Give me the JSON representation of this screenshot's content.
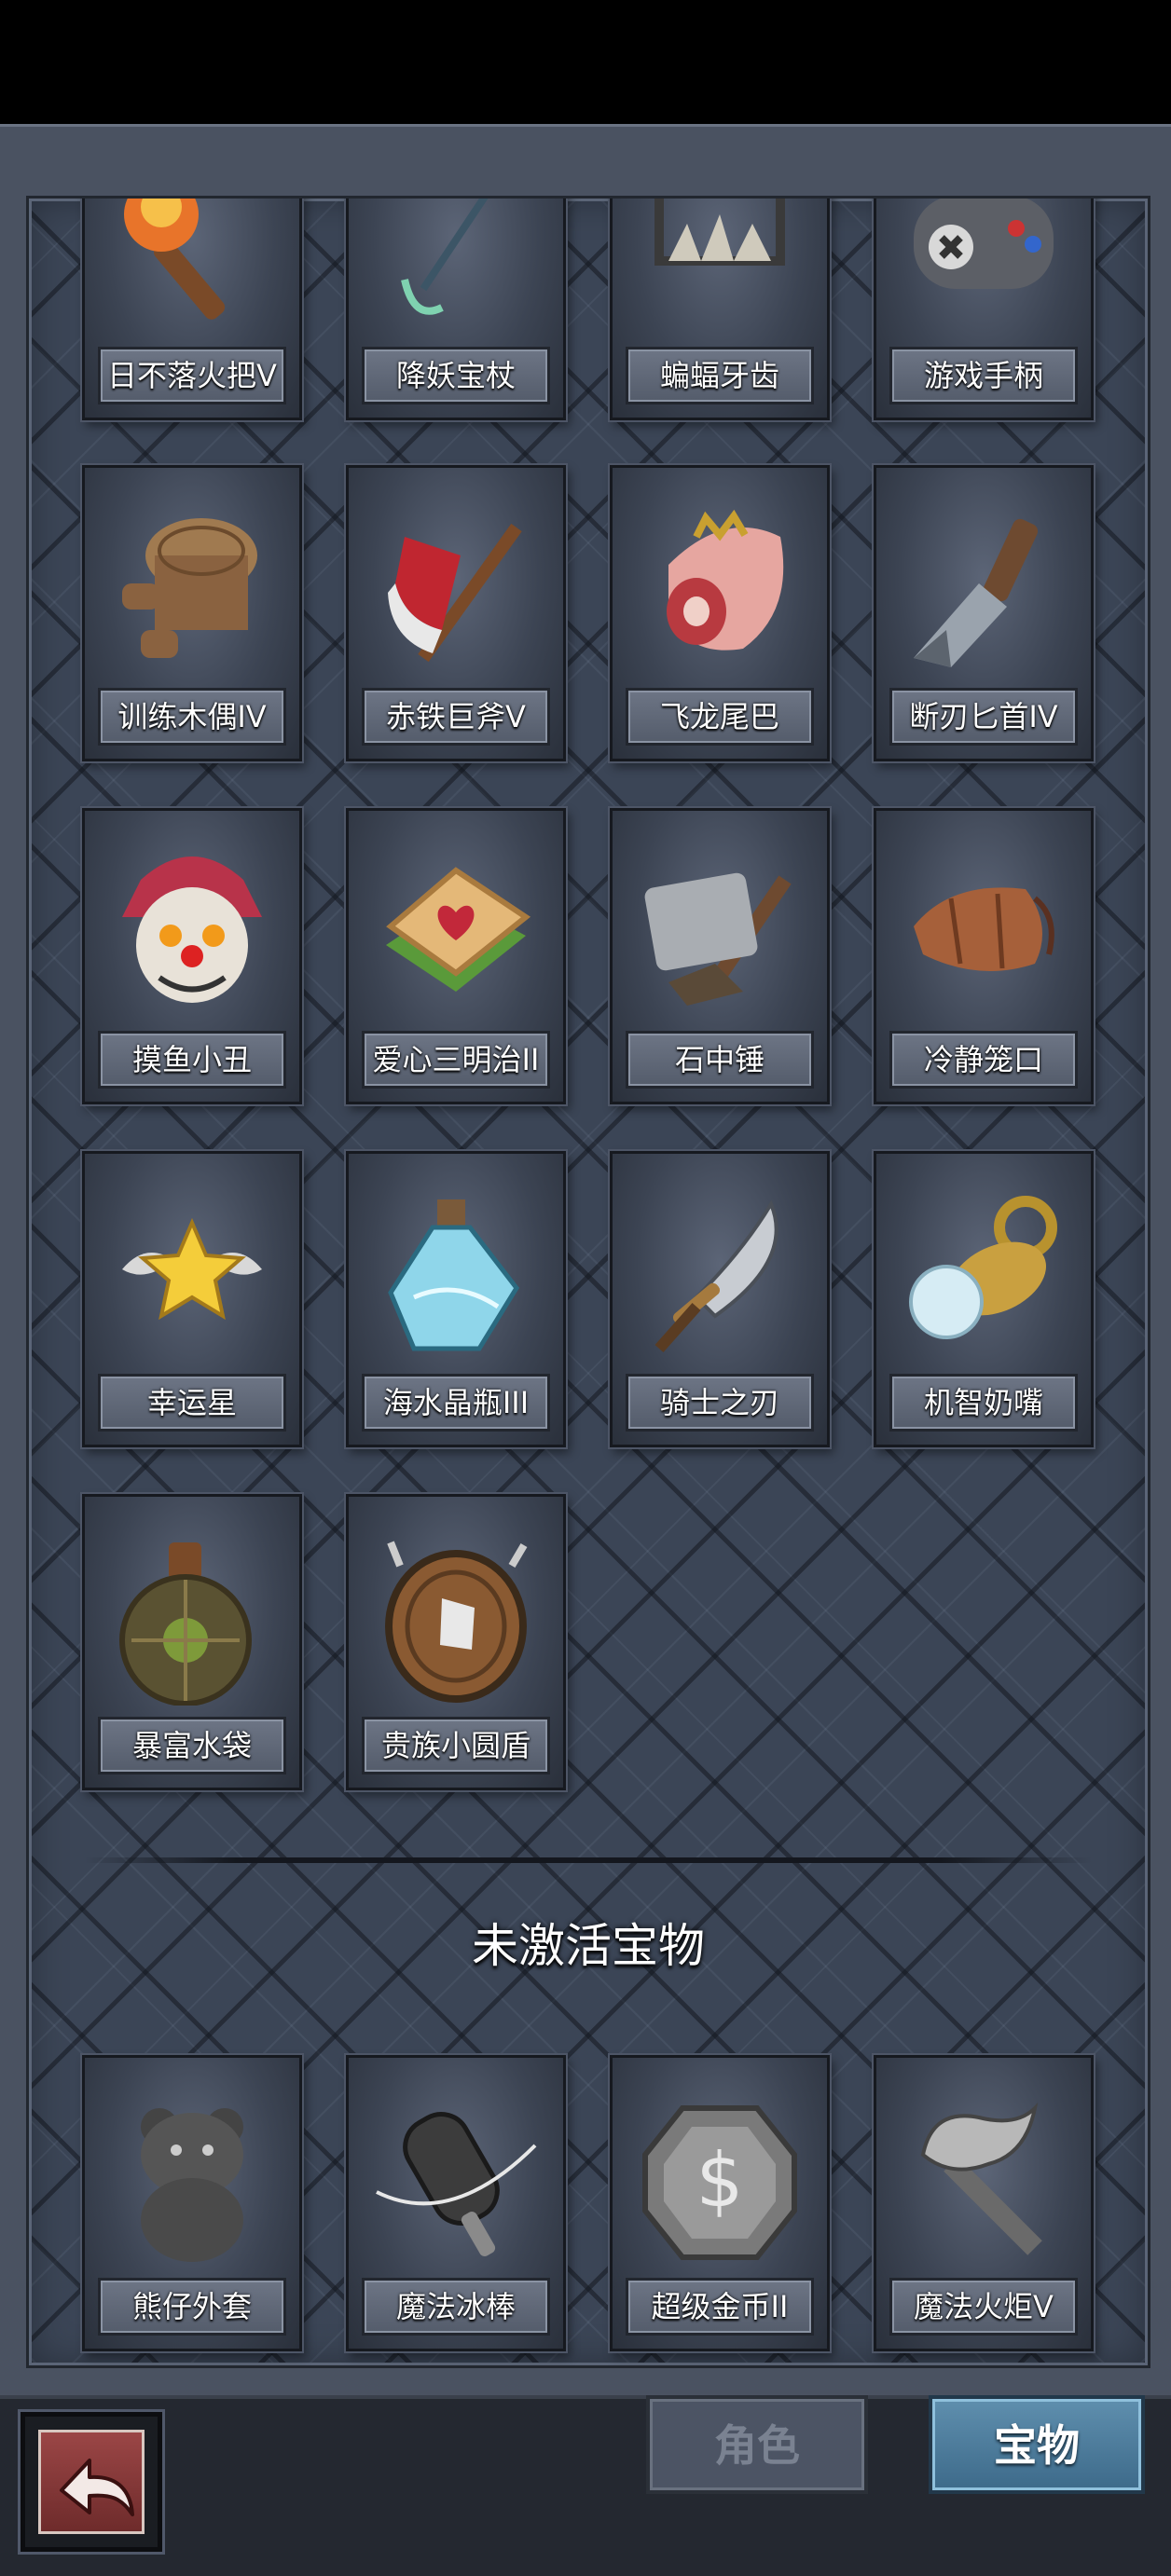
{
  "section_inactive_title": "未激活宝物",
  "active_treasures": [
    {
      "name": "日不落火把V",
      "icon": "torch-icon"
    },
    {
      "name": "降妖宝杖",
      "icon": "staff-icon"
    },
    {
      "name": "蝙蝠牙齿",
      "icon": "bat-teeth-icon"
    },
    {
      "name": "游戏手柄",
      "icon": "gamepad-icon"
    },
    {
      "name": "训练木偶IV",
      "icon": "wooden-dummy-icon"
    },
    {
      "name": "赤铁巨斧V",
      "icon": "red-axe-icon"
    },
    {
      "name": "飞龙尾巴",
      "icon": "dragon-tail-icon"
    },
    {
      "name": "断刃匕首IV",
      "icon": "broken-dagger-icon"
    },
    {
      "name": "摸鱼小丑",
      "icon": "jester-mask-icon"
    },
    {
      "name": "爱心三明治II",
      "icon": "heart-sandwich-icon"
    },
    {
      "name": "石中锤",
      "icon": "stone-hammer-icon"
    },
    {
      "name": "冷静笼口",
      "icon": "muzzle-icon"
    },
    {
      "name": "幸运星",
      "icon": "winged-star-icon"
    },
    {
      "name": "海水晶瓶III",
      "icon": "crystal-bottle-icon"
    },
    {
      "name": "骑士之刃",
      "icon": "knight-blade-icon"
    },
    {
      "name": "机智奶嘴",
      "icon": "pacifier-icon"
    },
    {
      "name": "暴富水袋",
      "icon": "water-flask-icon"
    },
    {
      "name": "贵族小圆盾",
      "icon": "round-shield-icon"
    }
  ],
  "inactive_treasures": [
    {
      "name": "熊仔外套",
      "icon": "bear-coat-icon"
    },
    {
      "name": "魔法冰棒",
      "icon": "ice-pop-icon"
    },
    {
      "name": "超级金币II",
      "icon": "gold-coin-icon"
    },
    {
      "name": "魔法火炬V",
      "icon": "magic-torch-icon"
    }
  ],
  "nav": {
    "back_icon": "back-arrow-icon",
    "tab_role_label": "角色",
    "tab_treasure_label": "宝物"
  }
}
